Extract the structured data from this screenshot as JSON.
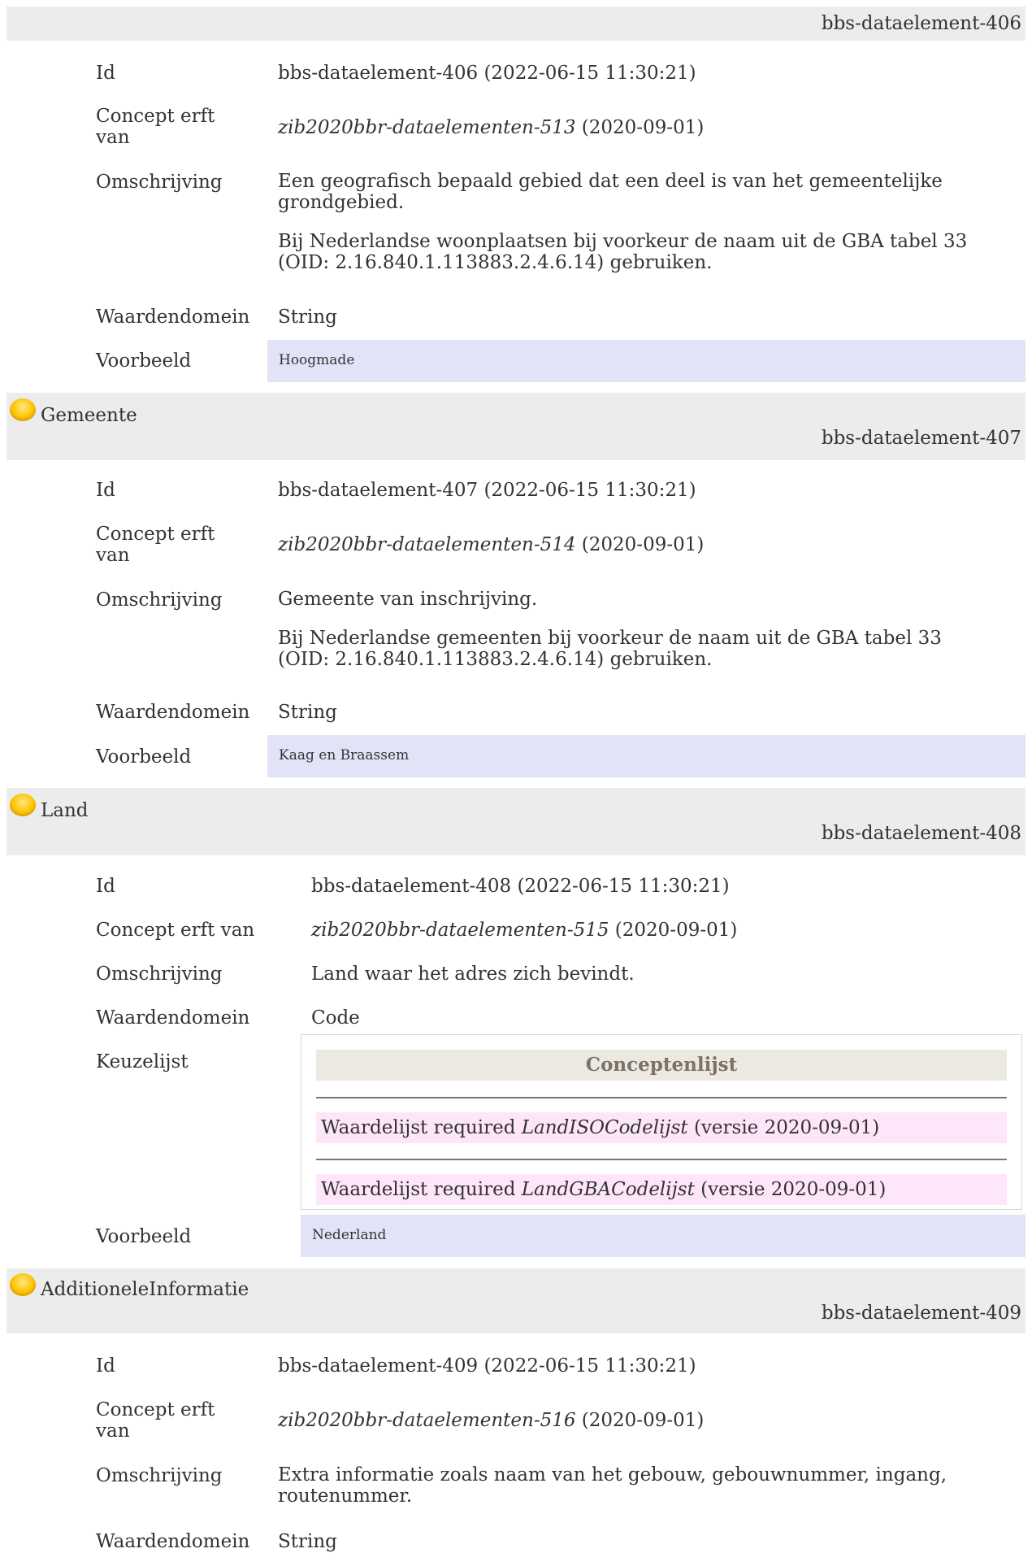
{
  "sections": [
    {
      "id_badge": "bbs-dataelement-406",
      "rows": {
        "id_label": "Id",
        "id_value": "bbs-dataelement-406 (2022-06-15 11:30:21)",
        "inherit_label_1": "Concept erft",
        "inherit_label_2": "van",
        "inherit_ref": "zib2020bbr-dataelementen-513",
        "inherit_date": "(2020-09-01)",
        "desc_label": "Omschrijving",
        "desc_p1_line1": "Een geografisch bepaald gebied dat een deel is van het gemeentelijke",
        "desc_p1_line2": "grondgebied.",
        "desc_p2_line1": "Bij Nederlandse woonplaatsen bij voorkeur de naam uit de GBA tabel 33",
        "desc_p2_line2": "(OID: 2.16.840.1.113883.2.4.6.14) gebruiken.",
        "domain_label": "Waardendomein",
        "domain_value": "String",
        "example_label": "Voorbeeld",
        "example_value": "Hoogmade"
      }
    },
    {
      "title": "Gemeente",
      "id_badge": "bbs-dataelement-407",
      "rows": {
        "id_label": "Id",
        "id_value": "bbs-dataelement-407 (2022-06-15 11:30:21)",
        "inherit_label_1": "Concept erft",
        "inherit_label_2": "van",
        "inherit_ref": "zib2020bbr-dataelementen-514",
        "inherit_date": "(2020-09-01)",
        "desc_label": "Omschrijving",
        "desc_p1_line1": "Gemeente van inschrijving.",
        "desc_p2_line1": "Bij Nederlandse gemeenten bij voorkeur de naam uit de GBA tabel 33",
        "desc_p2_line2": "(OID: 2.16.840.1.113883.2.4.6.14) gebruiken.",
        "domain_label": "Waardendomein",
        "domain_value": "String",
        "example_label": "Voorbeeld",
        "example_value": "Kaag en Braassem"
      }
    },
    {
      "title": "Land",
      "id_badge": "bbs-dataelement-408",
      "rows": {
        "id_label": "Id",
        "id_value": "bbs-dataelement-408 (2022-06-15 11:30:21)",
        "inherit_label": "Concept erft van",
        "inherit_ref": "zib2020bbr-dataelementen-515",
        "inherit_date": "(2020-09-01)",
        "desc_label": "Omschrijving",
        "desc_p1_line1": "Land waar het adres zich bevindt.",
        "domain_label": "Waardendomein",
        "domain_value": "Code",
        "choice_label": "Keuzelijst",
        "choice_header": "Conceptenlijst",
        "choice_items": [
          {
            "prefix": "Waardelijst required",
            "name": "LandISOCodelijst",
            "suffix": "(versie 2020-09-01)"
          },
          {
            "prefix": "Waardelijst required",
            "name": "LandGBACodelijst",
            "suffix": "(versie 2020-09-01)"
          }
        ],
        "example_label": "Voorbeeld",
        "example_value": "Nederland"
      }
    },
    {
      "title": "AdditioneleInformatie",
      "id_badge": "bbs-dataelement-409",
      "rows": {
        "id_label": "Id",
        "id_value": "bbs-dataelement-409 (2022-06-15 11:30:21)",
        "inherit_label_1": "Concept erft",
        "inherit_label_2": "van",
        "inherit_ref": "zib2020bbr-dataelementen-516",
        "inherit_date": "(2020-09-01)",
        "desc_label": "Omschrijving",
        "desc_p1_line1": "Extra informatie zoals naam van het gebouw, gebouwnummer, ingang,",
        "desc_p1_line2": "routenummer.",
        "domain_label": "Waardendomein",
        "domain_value": "String"
      }
    }
  ],
  "colors": {
    "header_bg": "#ececec",
    "example_bg": "#e3e3f7",
    "choice_header_bg": "#ece9e2",
    "choice_row_bg": "#fde6fa",
    "bullet": "#ffc400"
  },
  "icons": {
    "section_bullet": "yellow-circle-bullet-icon"
  }
}
